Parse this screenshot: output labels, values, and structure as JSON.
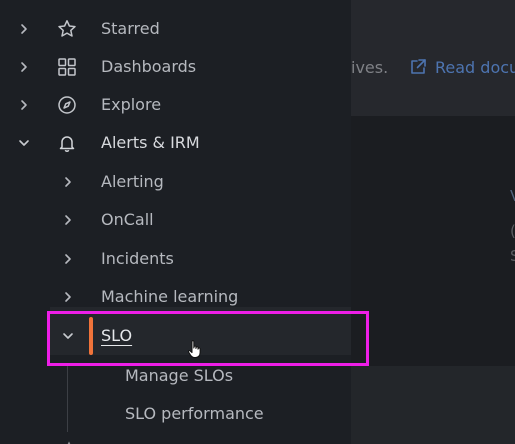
{
  "nav": {
    "items": [
      {
        "label": "Starred",
        "icon": "star-icon"
      },
      {
        "label": "Dashboards",
        "icon": "dashboards-grid-icon"
      },
      {
        "label": "Explore",
        "icon": "compass-icon"
      },
      {
        "label": "Alerts & IRM",
        "icon": "bell-icon",
        "expanded": true
      }
    ],
    "alerts_children": [
      {
        "label": "Alerting"
      },
      {
        "label": "OnCall"
      },
      {
        "label": "Incidents"
      },
      {
        "label": "Machine learning"
      },
      {
        "label": "SLO",
        "active": true,
        "expanded": true
      }
    ],
    "slo_children": [
      {
        "label": "Manage SLOs"
      },
      {
        "label": "SLO performance"
      }
    ]
  },
  "main": {
    "text_fragment": "ives.",
    "link_text": "Read docu",
    "edge_glyphs": [
      "V",
      "(",
      "S"
    ]
  },
  "colors": {
    "active_accent": "#f0733a",
    "highlight": "#ee1ee8",
    "link": "#4d74b0"
  }
}
